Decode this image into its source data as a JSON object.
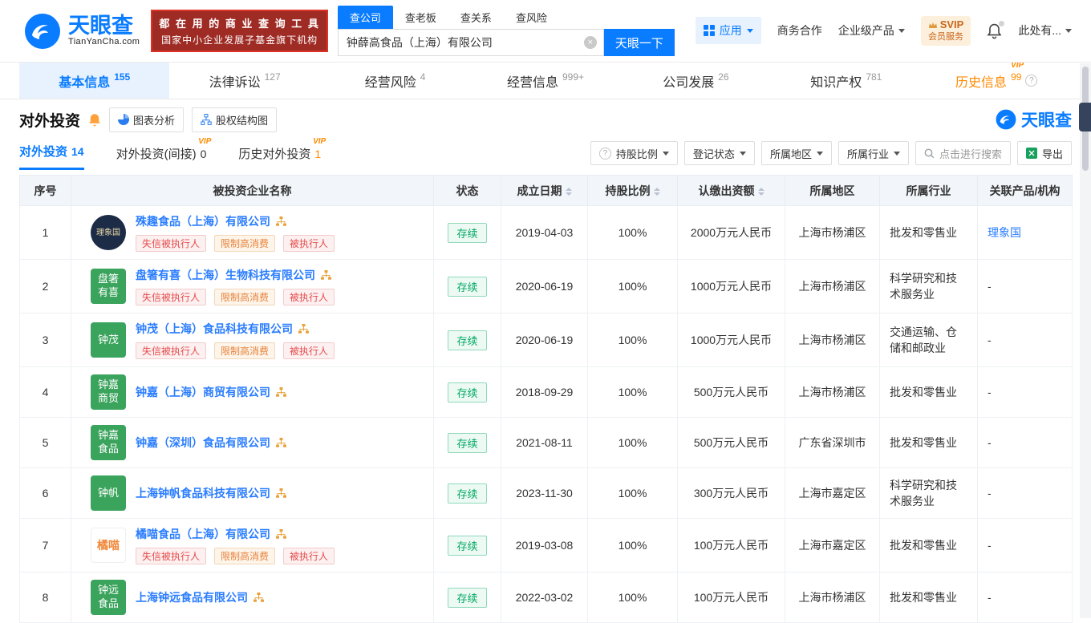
{
  "colors": {
    "brand_blue": "#0a7cff",
    "link_blue": "#2a7dff",
    "active_tab_bg": "#e8f2ff",
    "vip_orange": "#ff8a00",
    "status_green": "#00a861",
    "tag_red": "#e64c4c",
    "tag_orange": "#e8833a",
    "company_icon_green": "#3aa35c",
    "slogan_red": "#9e2b24"
  },
  "header": {
    "logo": {
      "title": "天眼查",
      "subtitle": "TianYanCha.com"
    },
    "slogan": {
      "line1": "都 在 用 的 商 业 查 询 工 具",
      "line2": "国家中小企业发展子基金旗下机构"
    },
    "search_tabs": [
      {
        "label": "查公司",
        "active": true
      },
      {
        "label": "查老板",
        "active": false
      },
      {
        "label": "查关系",
        "active": false
      },
      {
        "label": "查风险",
        "active": false
      }
    ],
    "search": {
      "value": "钟薛高食品（上海）有限公司",
      "button": "天眼一下"
    },
    "nav": {
      "apps": "应用",
      "cooperation": "商务合作",
      "enterprise": "企业级产品",
      "svip_top": "SVIP",
      "svip_bottom": "会员服务",
      "user": "此处有..."
    }
  },
  "main_tabs": [
    {
      "label": "基本信息",
      "count": "155",
      "active": true
    },
    {
      "label": "法律诉讼",
      "count": "127"
    },
    {
      "label": "经营风险",
      "count": "4"
    },
    {
      "label": "经营信息",
      "count": "999+"
    },
    {
      "label": "公司发展",
      "count": "26"
    },
    {
      "label": "知识产权",
      "count": "781"
    },
    {
      "label": "历史信息",
      "count": "99",
      "vip": true,
      "help": true
    }
  ],
  "section": {
    "title": "对外投资",
    "buttons": [
      {
        "label": "图表分析"
      },
      {
        "label": "股权结构图"
      }
    ],
    "brand": "天眼查"
  },
  "subtabs": [
    {
      "label": "对外投资",
      "count": "14",
      "active": true
    },
    {
      "label": "对外投资(间接)",
      "count": "0",
      "vip": true
    },
    {
      "label": "历史对外投资",
      "count": "1",
      "vip": true,
      "count_orange": true
    }
  ],
  "filters": [
    {
      "label": "持股比例",
      "help": true
    },
    {
      "label": "登记状态"
    },
    {
      "label": "所属地区"
    },
    {
      "label": "所属行业"
    }
  ],
  "search_filter": {
    "placeholder": "点击进行搜索"
  },
  "export": {
    "label": "导出"
  },
  "table": {
    "headers": [
      {
        "label": "序号"
      },
      {
        "label": "被投资企业名称"
      },
      {
        "label": "状态"
      },
      {
        "label": "成立日期",
        "sortable": true
      },
      {
        "label": "持股比例",
        "sortable": true
      },
      {
        "label": "认缴出资额",
        "sortable": true
      },
      {
        "label": "所属地区"
      },
      {
        "label": "所属行业"
      },
      {
        "label": "关联产品/机构"
      }
    ],
    "rows": [
      {
        "no": "1",
        "icon": {
          "lines": [
            "理象国"
          ],
          "variant": "dark"
        },
        "name": "殊趣食品（上海）有限公司",
        "tags": [
          {
            "label": "失信被执行人",
            "type": "red"
          },
          {
            "label": "限制高消费",
            "type": "orange"
          },
          {
            "label": "被执行人",
            "type": "red"
          }
        ],
        "status": "存续",
        "date": "2019-04-03",
        "ratio": "100%",
        "amount": "2000万元人民币",
        "region": "上海市杨浦区",
        "industry": "批发和零售业",
        "related": {
          "label": "理象国",
          "link": true
        }
      },
      {
        "no": "2",
        "icon": {
          "lines": [
            "盘箸",
            "有喜"
          ],
          "variant": "green"
        },
        "name": "盘箸有喜（上海）生物科技有限公司",
        "tags": [
          {
            "label": "失信被执行人",
            "type": "red"
          },
          {
            "label": "限制高消费",
            "type": "orange"
          },
          {
            "label": "被执行人",
            "type": "red"
          }
        ],
        "status": "存续",
        "date": "2020-06-19",
        "ratio": "100%",
        "amount": "1000万元人民币",
        "region": "上海市杨浦区",
        "industry": "科学研究和技术服务业",
        "related": {
          "label": "-",
          "link": false
        }
      },
      {
        "no": "3",
        "icon": {
          "lines": [
            "钟茂"
          ],
          "variant": "green"
        },
        "name": "钟茂（上海）食品科技有限公司",
        "tags": [
          {
            "label": "失信被执行人",
            "type": "red"
          },
          {
            "label": "限制高消费",
            "type": "orange"
          },
          {
            "label": "被执行人",
            "type": "red"
          }
        ],
        "status": "存续",
        "date": "2020-06-19",
        "ratio": "100%",
        "amount": "1000万元人民币",
        "region": "上海市杨浦区",
        "industry": "交通运输、仓储和邮政业",
        "related": {
          "label": "-",
          "link": false
        }
      },
      {
        "no": "4",
        "icon": {
          "lines": [
            "钟嘉",
            "商贸"
          ],
          "variant": "green"
        },
        "name": "钟嘉（上海）商贸有限公司",
        "tags": [],
        "status": "存续",
        "date": "2018-09-29",
        "ratio": "100%",
        "amount": "500万元人民币",
        "region": "上海市杨浦区",
        "industry": "批发和零售业",
        "related": {
          "label": "-",
          "link": false
        }
      },
      {
        "no": "5",
        "icon": {
          "lines": [
            "钟嘉",
            "食品"
          ],
          "variant": "green"
        },
        "name": "钟嘉（深圳）食品有限公司",
        "tags": [],
        "status": "存续",
        "date": "2021-08-11",
        "ratio": "100%",
        "amount": "500万元人民币",
        "region": "广东省深圳市",
        "industry": "批发和零售业",
        "related": {
          "label": "-",
          "link": false
        }
      },
      {
        "no": "6",
        "icon": {
          "lines": [
            "钟帆"
          ],
          "variant": "green"
        },
        "name": "上海钟帆食品科技有限公司",
        "tags": [],
        "status": "存续",
        "date": "2023-11-30",
        "ratio": "100%",
        "amount": "300万元人民币",
        "region": "上海市嘉定区",
        "industry": "科学研究和技术服务业",
        "related": {
          "label": "-",
          "link": false
        }
      },
      {
        "no": "7",
        "icon": {
          "lines": [
            "橘喵"
          ],
          "variant": "light"
        },
        "name": "橘喵食品（上海）有限公司",
        "tags": [
          {
            "label": "失信被执行人",
            "type": "red"
          },
          {
            "label": "限制高消费",
            "type": "orange"
          },
          {
            "label": "被执行人",
            "type": "red"
          }
        ],
        "status": "存续",
        "date": "2019-03-08",
        "ratio": "100%",
        "amount": "100万元人民币",
        "region": "上海市嘉定区",
        "industry": "批发和零售业",
        "related": {
          "label": "-",
          "link": false
        }
      },
      {
        "no": "8",
        "icon": {
          "lines": [
            "钟远",
            "食品"
          ],
          "variant": "green"
        },
        "name": "上海钟远食品有限公司",
        "tags": [],
        "status": "存续",
        "date": "2022-03-02",
        "ratio": "100%",
        "amount": "100万元人民币",
        "region": "上海市杨浦区",
        "industry": "批发和零售业",
        "related": {
          "label": "-",
          "link": false
        }
      }
    ]
  }
}
